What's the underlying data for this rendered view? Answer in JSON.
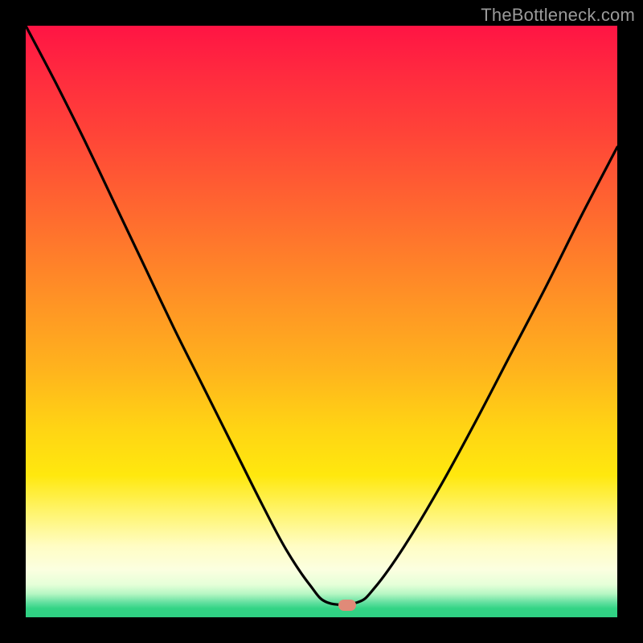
{
  "watermark": "TheBottleneck.com",
  "marker": {
    "cx_frac": 0.543,
    "cy_frac": 0.98
  },
  "chart_data": {
    "type": "line",
    "title": "",
    "xlabel": "",
    "ylabel": "",
    "xlim": [
      0,
      1
    ],
    "ylim": [
      0,
      1
    ],
    "note": "Axes are unlabeled; coordinates are fractions of the plot area (0,0 = top-left). The curve depicts a V-shaped bottleneck profile: a steep descent from top-left, a short flat trough near x≈0.51–0.56 at y≈0.975, then a shallower rise toward the right edge.",
    "series": [
      {
        "name": "bottleneck-curve",
        "x": [
          0.0,
          0.05,
          0.1,
          0.15,
          0.2,
          0.25,
          0.3,
          0.35,
          0.4,
          0.44,
          0.48,
          0.51,
          0.56,
          0.59,
          0.64,
          0.7,
          0.76,
          0.82,
          0.88,
          0.94,
          1.0
        ],
        "y": [
          0.0,
          0.095,
          0.195,
          0.3,
          0.405,
          0.51,
          0.61,
          0.71,
          0.81,
          0.885,
          0.945,
          0.975,
          0.975,
          0.95,
          0.88,
          0.78,
          0.67,
          0.555,
          0.44,
          0.32,
          0.205
        ]
      }
    ],
    "gradient_colormap": "red→orange→yellow→cream→green (vertical)",
    "marker": {
      "shape": "pill",
      "color": "#e08a78",
      "x_frac": 0.543,
      "y_frac": 0.98
    }
  }
}
